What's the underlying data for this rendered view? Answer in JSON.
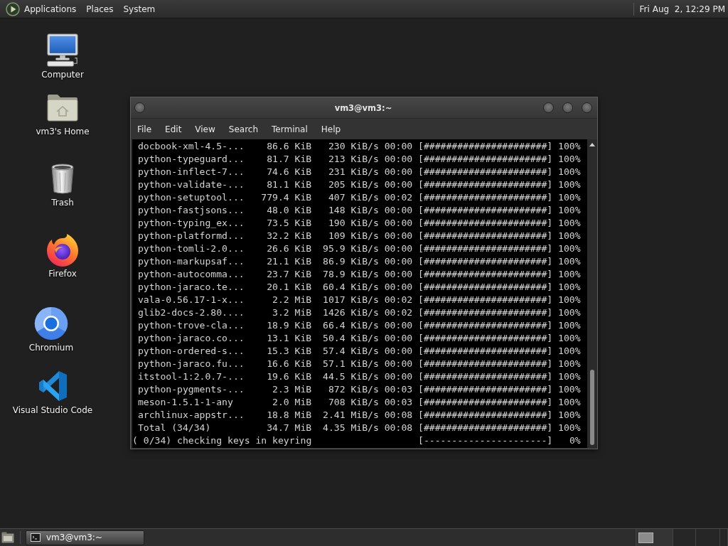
{
  "top_panel": {
    "menus": [
      "Applications",
      "Places",
      "System"
    ],
    "clock": "Fri Aug  2, 12:29 PM"
  },
  "desktop_icons": [
    {
      "label": "Computer",
      "kind": "computer"
    },
    {
      "label": "vm3's Home",
      "kind": "home"
    },
    {
      "label": "Trash",
      "kind": "trash"
    },
    {
      "label": "Firefox",
      "kind": "firefox"
    },
    {
      "label": "Chromium",
      "kind": "chromium"
    },
    {
      "label": "Visual Studio Code",
      "kind": "vscode"
    }
  ],
  "terminal_window": {
    "title": "vm3@vm3:~",
    "menu": [
      "File",
      "Edit",
      "View",
      "Search",
      "Terminal",
      "Help"
    ],
    "lines": [
      {
        "kind": "transfer",
        "text": "docbook-xml-4.5-...    86.6 KiB   230 KiB/s 00:00 [######################] 100%"
      },
      {
        "kind": "transfer",
        "text": "python-typeguard...    81.7 KiB   213 KiB/s 00:00 [######################] 100%"
      },
      {
        "kind": "transfer",
        "text": "python-inflect-7...    74.6 KiB   231 KiB/s 00:00 [######################] 100%"
      },
      {
        "kind": "transfer",
        "text": "python-validate-...    81.1 KiB   205 KiB/s 00:00 [######################] 100%"
      },
      {
        "kind": "transfer",
        "text": "python-setuptool...   779.4 KiB   407 KiB/s 00:02 [######################] 100%"
      },
      {
        "kind": "transfer",
        "text": "python-fastjsons...    48.0 KiB   148 KiB/s 00:00 [######################] 100%"
      },
      {
        "kind": "transfer",
        "text": "python-typing_ex...    73.5 KiB   190 KiB/s 00:00 [######################] 100%"
      },
      {
        "kind": "transfer",
        "text": "python-platformd...    32.2 KiB   109 KiB/s 00:00 [######################] 100%"
      },
      {
        "kind": "transfer",
        "text": "python-tomli-2.0...    26.6 KiB  95.9 KiB/s 00:00 [######################] 100%"
      },
      {
        "kind": "transfer",
        "text": "python-markupsaf...    21.1 KiB  86.9 KiB/s 00:00 [######################] 100%"
      },
      {
        "kind": "transfer",
        "text": "python-autocomma...    23.7 KiB  78.9 KiB/s 00:00 [######################] 100%"
      },
      {
        "kind": "transfer",
        "text": "python-jaraco.te...    20.1 KiB  60.4 KiB/s 00:00 [######################] 100%"
      },
      {
        "kind": "transfer",
        "text": "vala-0.56.17-1-x...     2.2 MiB  1017 KiB/s 00:02 [######################] 100%"
      },
      {
        "kind": "transfer",
        "text": "glib2-docs-2.80....     3.2 MiB  1426 KiB/s 00:02 [######################] 100%"
      },
      {
        "kind": "transfer",
        "text": "python-trove-cla...    18.9 KiB  66.4 KiB/s 00:00 [######################] 100%"
      },
      {
        "kind": "transfer",
        "text": "python-jaraco.co...    13.1 KiB  50.4 KiB/s 00:00 [######################] 100%"
      },
      {
        "kind": "transfer",
        "text": "python-ordered-s...    15.3 KiB  57.4 KiB/s 00:00 [######################] 100%"
      },
      {
        "kind": "transfer",
        "text": "python-jaraco.fu...    16.6 KiB  57.1 KiB/s 00:00 [######################] 100%"
      },
      {
        "kind": "transfer",
        "text": "itstool-1:2.0.7-...    19.6 KiB  44.5 KiB/s 00:00 [######################] 100%"
      },
      {
        "kind": "transfer",
        "text": "python-pygments-...     2.3 MiB   872 KiB/s 00:03 [######################] 100%"
      },
      {
        "kind": "transfer",
        "text": "meson-1.5.1-1-any       2.0 MiB   708 KiB/s 00:03 [######################] 100%"
      },
      {
        "kind": "transfer",
        "text": "archlinux-appstr...    18.8 MiB  2.41 MiB/s 00:08 [######################] 100%"
      },
      {
        "kind": "transfer",
        "text": "Total (34/34)          34.7 MiB  4.35 MiB/s 00:08 [######################] 100%"
      },
      {
        "kind": "status",
        "text": "( 0/34) checking keys in keyring                   [----------------------]   0%"
      }
    ]
  },
  "bottom_panel": {
    "tasks": [
      {
        "label": "vm3@vm3:~",
        "selected": true
      }
    ],
    "workspaces": [
      {
        "selected": true,
        "has_window": true
      },
      {
        "selected": false,
        "has_window": false
      },
      {
        "selected": false,
        "has_window": false
      },
      {
        "selected": false,
        "has_window": false
      }
    ]
  }
}
